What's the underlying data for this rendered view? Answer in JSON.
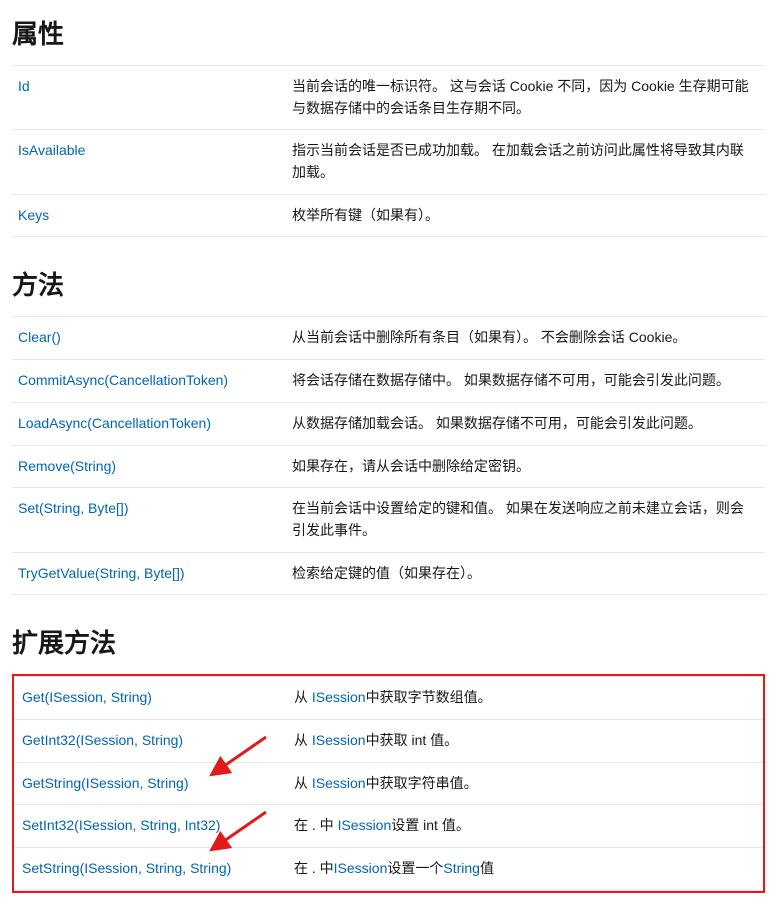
{
  "sections": {
    "properties": {
      "heading": "属性",
      "rows": [
        {
          "name": "Id",
          "desc": "当前会话的唯一标识符。 这与会话 Cookie 不同，因为 Cookie 生存期可能与数据存储中的会话条目生存期不同。"
        },
        {
          "name": "IsAvailable",
          "desc": "指示当前会话是否已成功加载。 在加载会话之前访问此属性将导致其内联加载。"
        },
        {
          "name": "Keys",
          "desc": "枚举所有键（如果有）。"
        }
      ]
    },
    "methods": {
      "heading": "方法",
      "rows": [
        {
          "name": "Clear()",
          "desc": "从当前会话中删除所有条目（如果有）。 不会删除会话 Cookie。"
        },
        {
          "name": "CommitAsync(CancellationToken)",
          "desc": "将会话存储在数据存储中。 如果数据存储不可用，可能会引发此问题。"
        },
        {
          "name": "LoadAsync(CancellationToken)",
          "desc": "从数据存储加载会话。 如果数据存储不可用，可能会引发此问题。"
        },
        {
          "name": "Remove(String)",
          "desc": "如果存在，请从会话中删除给定密钥。"
        },
        {
          "name": "Set(String, Byte[])",
          "desc": "在当前会话中设置给定的键和值。 如果在发送响应之前未建立会话，则会引发此事件。"
        },
        {
          "name": "TryGetValue(String, Byte[])",
          "desc": "检索给定键的值（如果存在）。"
        }
      ]
    },
    "extensions": {
      "heading": "扩展方法",
      "rows": [
        {
          "name": "Get(ISession, String)",
          "desc_pre": "从 ",
          "link": "ISession",
          "desc_post": "中获取字节数组值。"
        },
        {
          "name": "GetInt32(ISession, String)",
          "desc_pre": "从 ",
          "link": "ISession",
          "desc_post": "中获取 int 值。"
        },
        {
          "name": "GetString(ISession, String)",
          "desc_pre": "从 ",
          "link": "ISession",
          "desc_post": "中获取字符串值。"
        },
        {
          "name": "SetInt32(ISession, String, Int32)",
          "desc_pre": "在 . 中 ",
          "link": "ISession",
          "desc_post": "设置 int 值。"
        },
        {
          "name": "SetString(ISession, String, String)",
          "desc_pre": "在 . 中",
          "link": "ISession",
          "desc_post": "设置一个",
          "link2": "String",
          "desc_post2": "值"
        }
      ]
    }
  }
}
